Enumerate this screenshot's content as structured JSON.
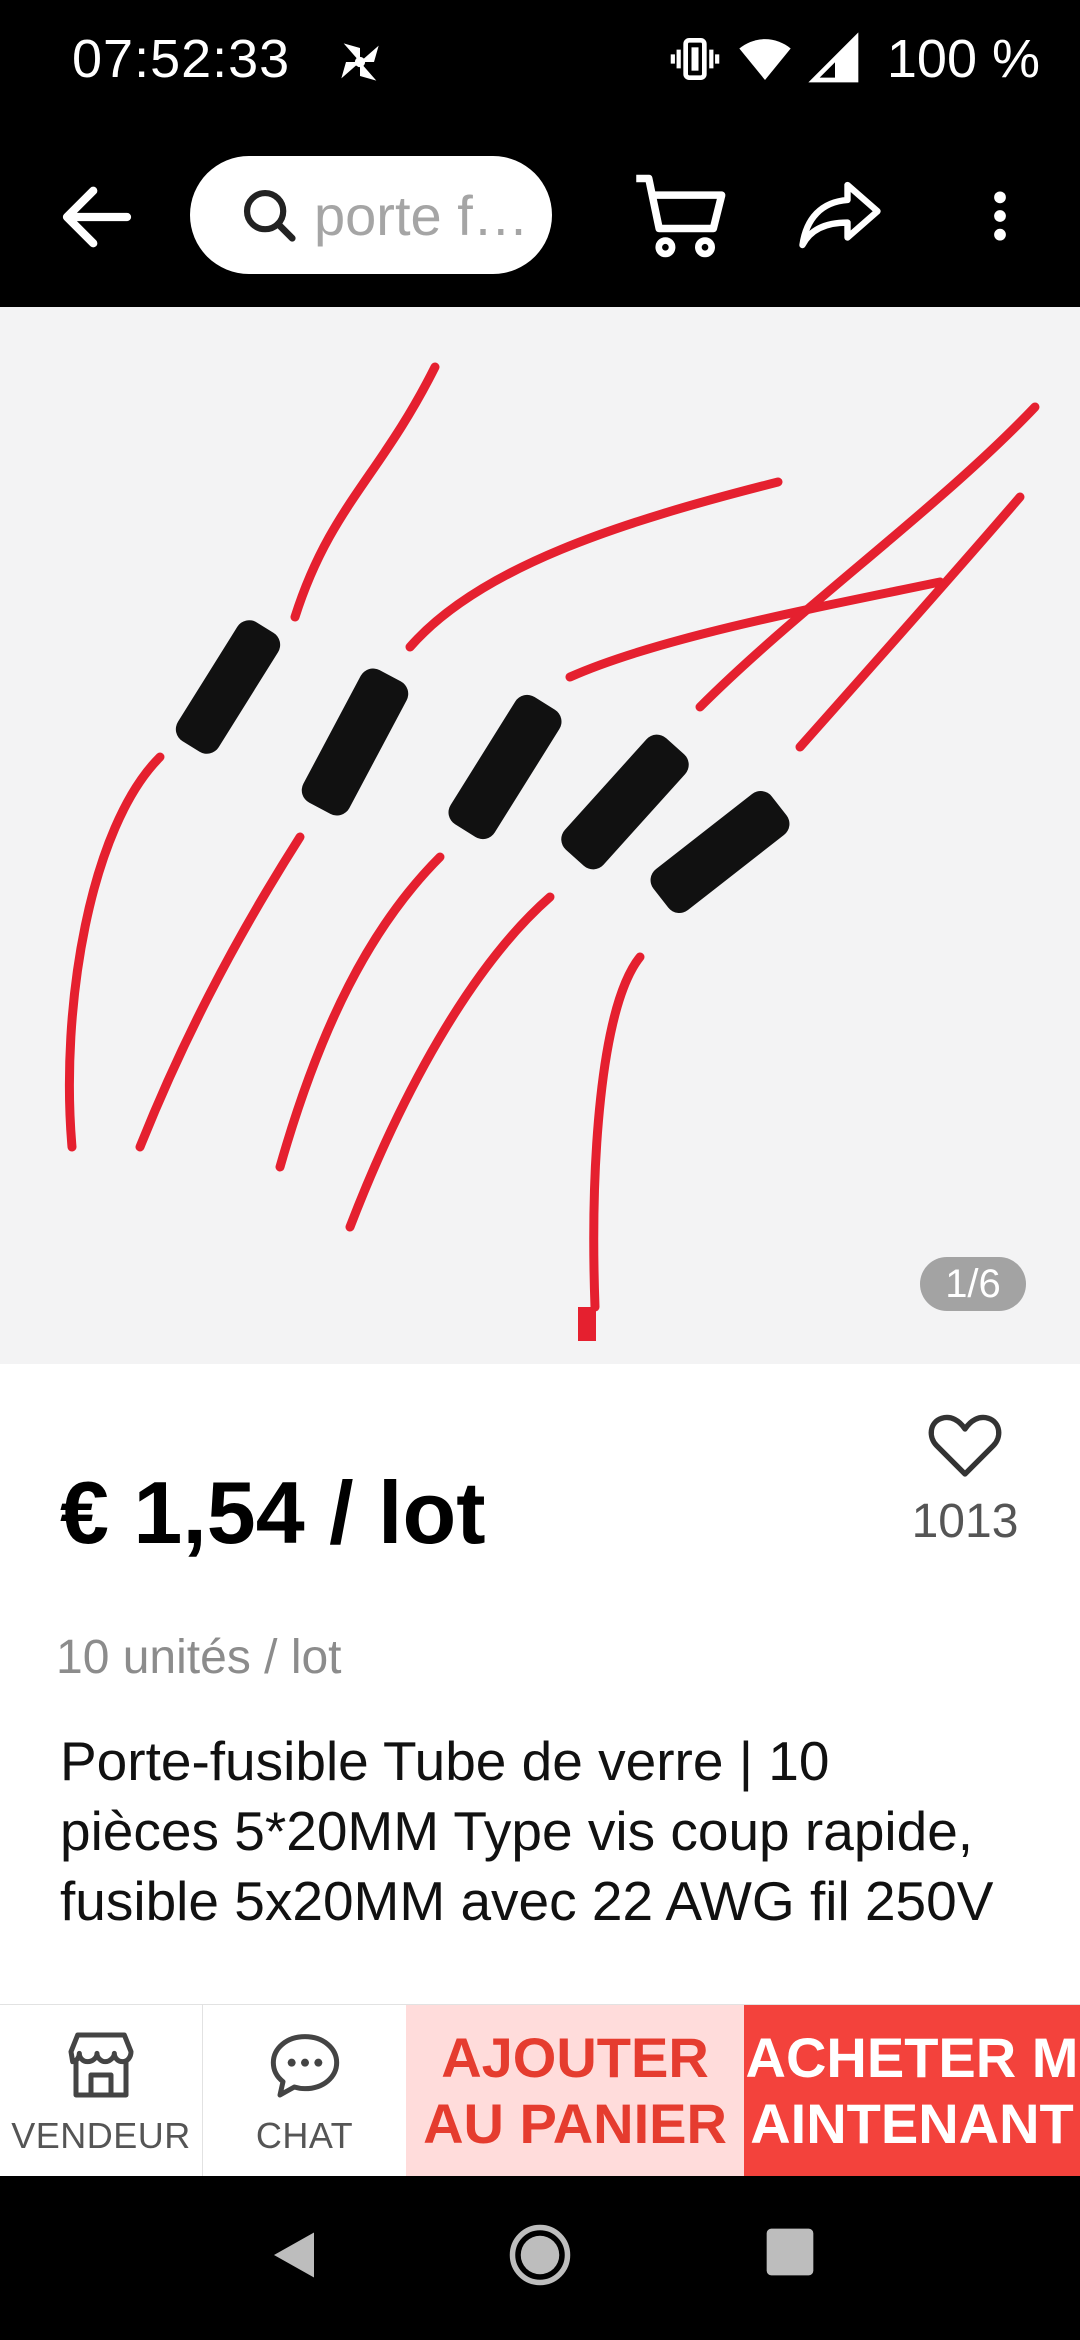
{
  "status_bar": {
    "time": "07:52:33",
    "battery": "100 %",
    "icons": [
      "notification-pinwheel-icon",
      "vibrate-icon",
      "wifi-icon",
      "cellular-signal-icon"
    ]
  },
  "toolbar": {
    "search_placeholder": "porte f…",
    "icons": [
      "back-arrow-icon",
      "search-icon",
      "cart-icon",
      "share-icon",
      "more-vert-icon"
    ]
  },
  "gallery": {
    "counter": "1/6"
  },
  "product": {
    "price": "€ 1,54 / lot",
    "units": "10 unités / lot",
    "wishlist_count": "1013",
    "title": "Porte-fusible Tube de verre | 10 pièces 5*20MM Type vis coup rapide, fusible 5x20MM avec 22 AWG fil 250V"
  },
  "action_bar": {
    "vendor_label": "VENDEUR",
    "chat_label": "CHAT",
    "add_to_cart_label": "AJOUTER AU PANIER",
    "buy_now_label": "ACHETER MAINTENANT"
  },
  "colors": {
    "cart_button_bg": "#ffdcdb",
    "cart_button_text": "#e53c2f",
    "buy_button_bg": "#f3423c",
    "wire_red": "#e5202f"
  }
}
